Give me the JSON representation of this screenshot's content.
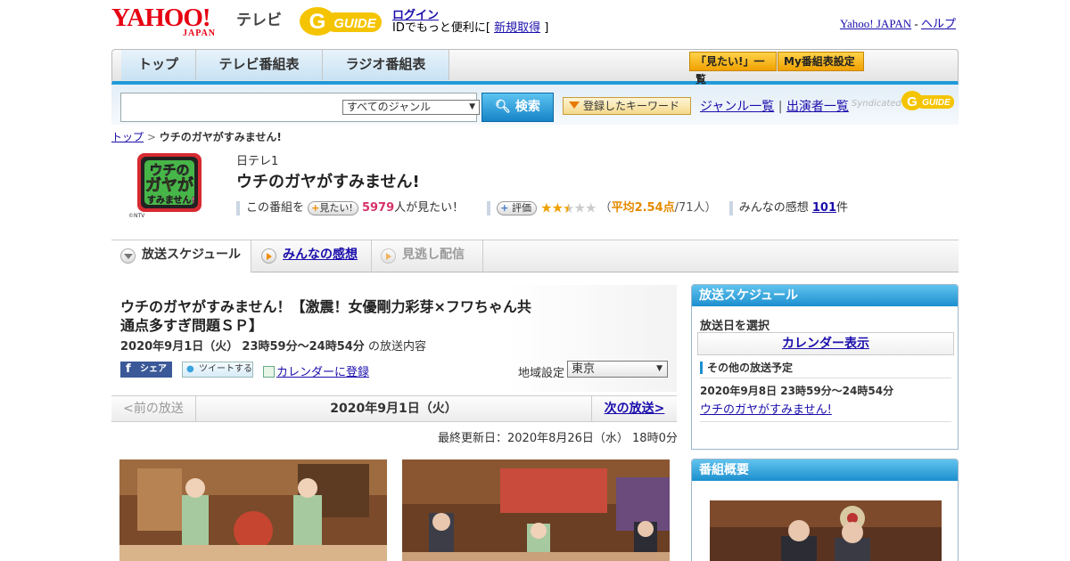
{
  "header": {
    "yahoo_text": "YAHOO!",
    "japan_text": "JAPAN",
    "tv_label": "テレビ",
    "gguide_label": "G GUIDE",
    "login": "ログイン",
    "id_prefix": "IDでもっと便利に[",
    "signup": "新規取得",
    "id_suffix": "]",
    "yahoo_japan_link": "Yahoo! JAPAN",
    "dash": "-",
    "help_link": "ヘルプ"
  },
  "nav": {
    "tabs": [
      "トップ",
      "テレビ番組表",
      "ラジオ番組表"
    ],
    "mitai_list": "「見たい!」一覧",
    "my_schedule": "My番組表設定"
  },
  "search": {
    "genre_selected": "すべてのジャンル",
    "search_button": "検索",
    "keyword_button": "登録したキーワード",
    "genre_list": "ジャンル一覧",
    "divider": "|",
    "performer_list": "出演者一覧",
    "syndicated": "Syndicated",
    "gguide_small": "G GUIDE"
  },
  "breadcrumb": {
    "top": "トップ",
    "separator": ">",
    "current": "ウチのガヤがすみません!"
  },
  "program": {
    "logo_text": "ウチのガヤがすみません!",
    "logo_credit": "©NTV",
    "channel": "日テレ1",
    "title": "ウチのガヤがすみません!",
    "this_program": "この番組を",
    "mitai_button": "見たい!",
    "mitai_count": "5979",
    "mitai_suffix": "人が見たい！",
    "rate_button": "評価",
    "stars_filled": 2.5,
    "rating_open": "（",
    "rating_label": "平均2.54点",
    "rating_count": "/71人）",
    "comments_label": "みんなの感想",
    "comments_count": "101",
    "comments_suffix": "件"
  },
  "subtabs": {
    "schedule": "放送スケジュール",
    "comments": "みんなの感想",
    "streaming": "見逃し配信"
  },
  "episode": {
    "title": "ウチのガヤがすみません！【激震！女優剛力彩芽×フワちゃん共通点多すぎ問題ＳＰ】",
    "date": "2020年9月1日（火）",
    "time": "23時59分～24時54分",
    "suffix": "の放送内容",
    "share_fb": "シェア",
    "share_tw": "ツイートする",
    "calendar_register": "カレンダーに登録",
    "region_label": "地域設定",
    "region_selected": "東京"
  },
  "pager": {
    "prev": "<前の放送",
    "current": "2020年9月1日（火）",
    "next": "次の放送>"
  },
  "updated": "最終更新日：2020年8月26日（水） 18時0分",
  "sidebar": {
    "schedule_head": "放送スケジュール",
    "select_date": "放送日を選択",
    "calendar_button": "カレンダー表示",
    "other_label": "その他の放送予定",
    "other_date": "2020年9月8日 23時59分～24時54分",
    "other_link": "ウチのガヤがすみません!",
    "overview_head": "番組概要"
  },
  "colors": {
    "accent_blue": "#1f9ad9",
    "yahoo_red": "#e60012",
    "gguide_yellow": "#f5c400",
    "mitai_pink": "#d6336c",
    "rating_orange": "#e58a00"
  }
}
